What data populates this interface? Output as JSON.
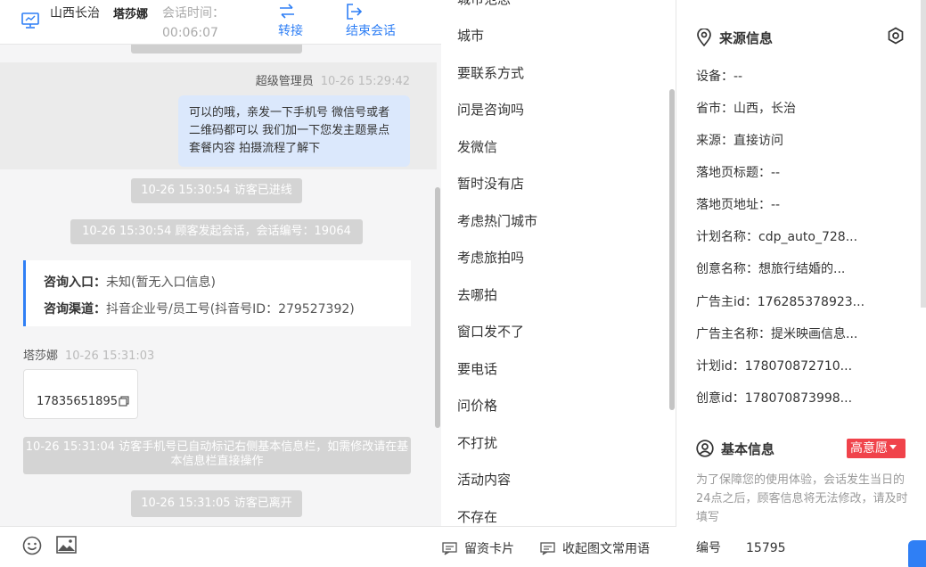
{
  "header": {
    "location": "山西长治",
    "visitor_name": "塔莎娜",
    "session_time_label": "会话时间：",
    "session_time_value": "00:06:07",
    "transfer_label": "转接",
    "end_label": "结束会话"
  },
  "chat": {
    "agent_name": "超级管理员",
    "agent_time": "10-26 15:29:42",
    "agent_message": "可以的哦，亲发一下手机号 微信号或者二维码都可以 我们加一下您发主题景点 套餐内容 拍摄流程了解下",
    "sys_enter": "10-26 15:30:54 访客已进线",
    "sys_start": "10-26 15:30:54 顾客发起会话，会话编号：19064",
    "entry_label": "咨询入口：",
    "entry_value": "未知(暂无入口信息)",
    "channel_label": "咨询渠道：",
    "channel_value": "抖音企业号/员工号(抖音号ID：279527392)",
    "visitor_name": "塔莎娜",
    "visitor_time": "10-26 15:31:03",
    "visitor_phone": "17835651895",
    "sys_phone_tag": "10-26 15:31:04 访客手机号已自动标记右侧基本信息栏，如需修改请在基本信息栏直接操作",
    "sys_leave": "10-26 15:31:05 访客已离开"
  },
  "footer": {
    "card_label": "留资卡片",
    "collapse_label": "收起图文常用语"
  },
  "phrases": [
    "城市范思",
    "城市",
    "要联系方式",
    "问是咨询吗",
    "发微信",
    "暂时没有店",
    "考虑热门城市",
    "考虑旅拍吗",
    "去哪拍",
    "窗口发不了",
    "要电话",
    "问价格",
    "不打扰",
    "活动内容",
    "不存在"
  ],
  "source": {
    "title": "来源信息",
    "rows": [
      "设备：--",
      "省市：山西，长治",
      "来源：直接访问",
      "落地页标题：--",
      "落地页地址：--",
      "计划名称：cdp_auto_728...",
      "创意名称：想旅行结婚的...",
      "广告主id：176285378923...",
      "广告主名称：提米映画信息...",
      "计划id：178070872710...",
      "创意id：178070873998..."
    ]
  },
  "basic": {
    "title": "基本信息",
    "intent": "高意愿",
    "notice": "为了保障您的使用体验，会话发生当日的24点之后，顾客信息将无法修改，请及时填写",
    "id_label": "编号",
    "id_value": "15795"
  },
  "colors": {
    "accent": "#2f7ff5",
    "agent_bubble": "#dbe8fc",
    "intent_badge": "#f0434b",
    "system_pill": "#d4d4d4"
  },
  "icons": [
    "monitor-icon",
    "transfer-icon",
    "exit-icon",
    "emoji-icon",
    "image-icon",
    "card-icon",
    "collapse-icon",
    "location-pin-icon",
    "settings-icon",
    "user-circle-icon",
    "copy-icon"
  ]
}
